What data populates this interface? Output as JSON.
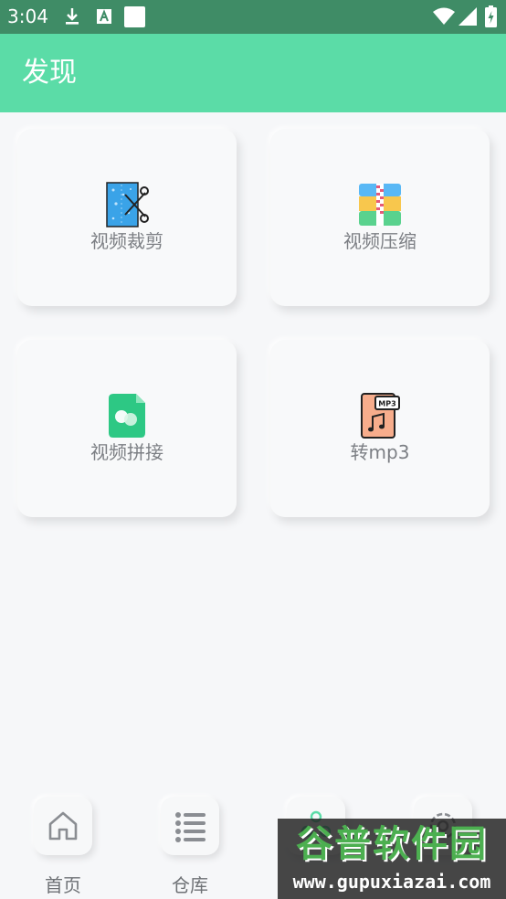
{
  "status_bar": {
    "time": "3:04",
    "icons": [
      "download-icon",
      "a-icon",
      "square-icon",
      "wifi-icon",
      "signal-icon",
      "battery-icon"
    ]
  },
  "app_bar": {
    "title": "发现"
  },
  "features": [
    {
      "label": "视频裁剪",
      "icon": "video-trim-icon"
    },
    {
      "label": "视频压缩",
      "icon": "video-compress-icon"
    },
    {
      "label": "视频拼接",
      "icon": "video-merge-icon"
    },
    {
      "label": "转mp3",
      "icon": "mp3-icon",
      "icon_text": "MP3"
    }
  ],
  "bottom_nav": [
    {
      "label": "首页",
      "icon": "home-icon"
    },
    {
      "label": "仓库",
      "icon": "list-icon"
    },
    {
      "label": "",
      "icon": "discover-icon",
      "active": true
    },
    {
      "label": "",
      "icon": "settings-icon"
    }
  ],
  "watermark": {
    "title": "谷普软件园",
    "url": "www.gupuxiazai.com"
  },
  "colors": {
    "accent": "#5bdca7",
    "status_bar": "#3f8c66",
    "background": "#f6f7f9",
    "label": "#7c7f84"
  }
}
